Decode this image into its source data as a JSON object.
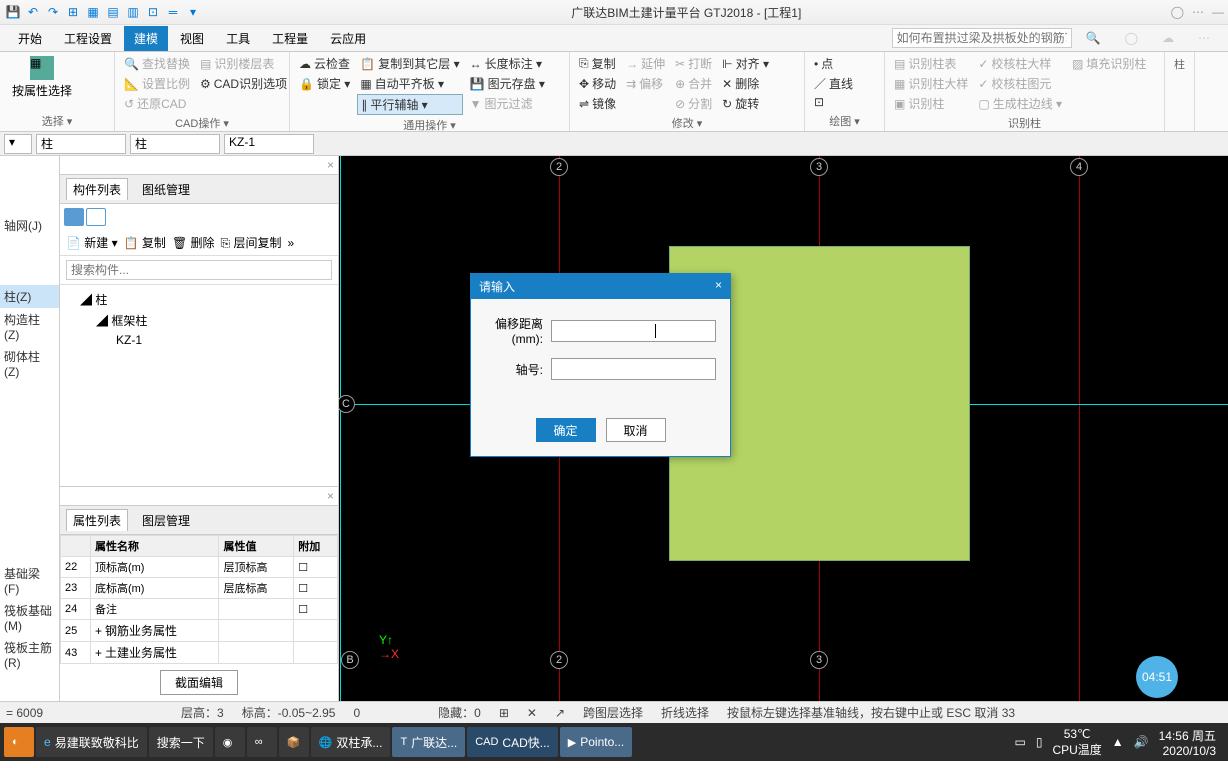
{
  "title": "广联达BIM土建计量平台 GTJ2018 - [工程1]",
  "menus": [
    "开始",
    "工程设置",
    "建模",
    "视图",
    "工具",
    "工程量",
    "云应用"
  ],
  "active_menu": 2,
  "search_placeholder": "如何布置拱过梁及拱板处的钢筋？",
  "ribbon": {
    "select": {
      "by_prop": "按属性选择",
      "title": "选择 ▾"
    },
    "cad": {
      "find": "查找替换",
      "set_scale": "设置比例",
      "restore": "还原CAD",
      "recog_table": "识别楼层表",
      "opt": "CAD识别选项",
      "title": "CAD操作 ▾"
    },
    "common": {
      "cloud": "云检查",
      "lock": "锁定 ▾",
      "copy_floor": "复制到其它层 ▾",
      "auto_align": "自动平齐板 ▾",
      "parallel": "平行辅轴 ▾",
      "dim": "长度标注 ▾",
      "elem": "图元存盘 ▾",
      "filter": "图元过滤",
      "title": "通用操作 ▾"
    },
    "modify": {
      "copy": "复制",
      "move": "移动",
      "mirror": "镜像",
      "extend": "延伸",
      "break": "打断",
      "align": "对齐 ▾",
      "merge": "合并",
      "offset": "偏移",
      "split": "分割",
      "delete": "删除",
      "rotate": "旋转",
      "title": "修改 ▾"
    },
    "draw": {
      "point": "点",
      "line": "直线",
      "title": "绘图 ▾"
    },
    "column": {
      "recog_table": "识别柱表",
      "recog_style": "识别柱大样",
      "recog": "识别柱",
      "check_style": "校核柱大样",
      "check_elem": "校核柱图元",
      "gen_edge": "生成柱边线 ▾",
      "fill": "填充识别柱",
      "title": "识别柱"
    },
    "col2": {
      "title": "柱"
    }
  },
  "selectors": [
    "▾",
    "柱",
    "柱",
    "KZ-1"
  ],
  "left_tree": {
    "axis": "轴网(J)",
    "col": "柱(Z)",
    "struct": "构造柱(Z)",
    "masonry": "砌体柱(Z)",
    "beam": "基础梁(F)",
    "raft": "筏板基础(M)",
    "raft_rebar": "筏板主筋(R)"
  },
  "comp_panel": {
    "tab1": "构件列表",
    "tab2": "图纸管理",
    "new": "新建 ▾",
    "copy": "复制",
    "delete": "删除",
    "floor_copy": "层间复制",
    "search": "搜索构件...",
    "tree": {
      "root": "柱",
      "l2": "框架柱",
      "l3": "KZ-1"
    }
  },
  "prop_panel": {
    "tab1": "属性列表",
    "tab2": "图层管理",
    "headers": [
      "",
      "属性名称",
      "属性值",
      "附加"
    ],
    "rows": [
      {
        "n": "22",
        "name": "顶标高(m)",
        "val": "层顶标高"
      },
      {
        "n": "23",
        "name": "底标高(m)",
        "val": "层底标高"
      },
      {
        "n": "24",
        "name": "备注",
        "val": ""
      },
      {
        "n": "25",
        "name": "钢筋业务属性",
        "val": "",
        "exp": "+"
      },
      {
        "n": "43",
        "name": "土建业务属性",
        "val": "",
        "exp": "+"
      }
    ],
    "section": "截面编辑"
  },
  "grid": {
    "v": [
      "2",
      "3",
      "4"
    ],
    "h": [
      "C",
      "B"
    ]
  },
  "dialog": {
    "title": "请输入",
    "offset_label": "偏移距离(mm):",
    "axis_label": "轴号:",
    "ok": "确定",
    "cancel": "取消"
  },
  "status": {
    "val": "= 6009",
    "floor_h": "层高：3",
    "elev": "标高：-0.05~2.95",
    "zero": "0",
    "hidden": "隐藏：0",
    "cross": "跨图层选择",
    "polyline": "折线选择",
    "hint": "按鼠标左键选择基准轴线，按右键中止或 ESC 取消  33"
  },
  "taskbar": {
    "items": [
      "易建联致敬科比",
      "搜索一下",
      "双柱承...",
      "广联达...",
      "CAD快...",
      "Pointo..."
    ],
    "temp": "53℃",
    "cpu": "CPU温度",
    "time": "14:56 周五",
    "date": "2020/10/3"
  },
  "timer": "04:51"
}
